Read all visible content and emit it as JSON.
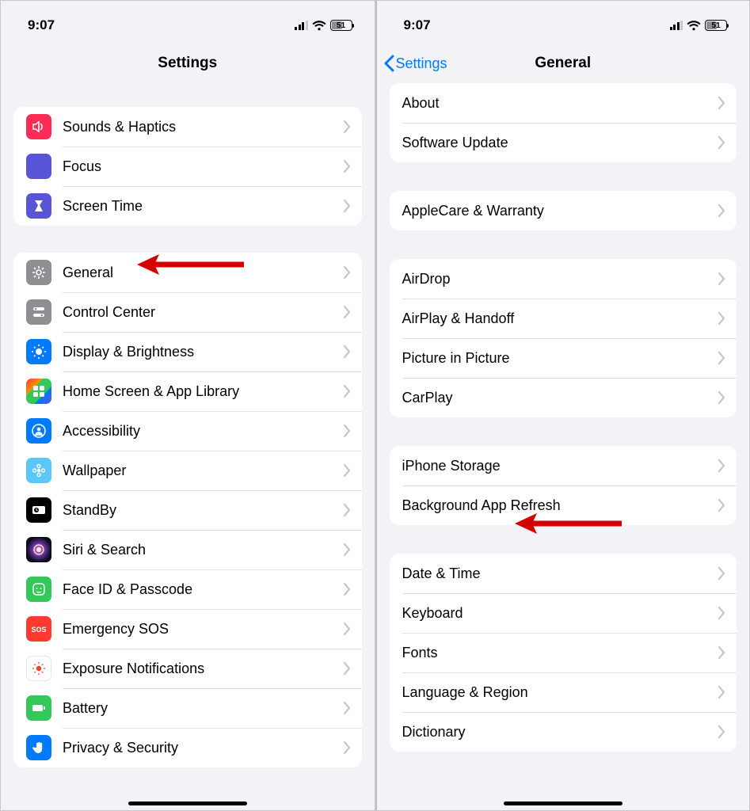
{
  "status": {
    "time": "9:07",
    "battery": "51"
  },
  "left": {
    "navTitle": "Settings",
    "groups": [
      {
        "items": [
          {
            "name": "sounds-haptics",
            "label": "Sounds & Haptics",
            "iconClass": "ic-pink",
            "icon": "speaker"
          },
          {
            "name": "focus",
            "label": "Focus",
            "iconClass": "ic-indigo",
            "icon": "moon"
          },
          {
            "name": "screen-time",
            "label": "Screen Time",
            "iconClass": "ic-hourglass",
            "icon": "hourglass"
          }
        ]
      },
      {
        "items": [
          {
            "name": "general",
            "label": "General",
            "iconClass": "ic-gray",
            "icon": "gear"
          },
          {
            "name": "control-center",
            "label": "Control Center",
            "iconClass": "ic-gray",
            "icon": "switches"
          },
          {
            "name": "display-brightness",
            "label": "Display & Brightness",
            "iconClass": "ic-blue",
            "icon": "sun"
          },
          {
            "name": "home-screen",
            "label": "Home Screen & App Library",
            "iconClass": "ic-multicolor",
            "icon": "grid"
          },
          {
            "name": "accessibility",
            "label": "Accessibility",
            "iconClass": "ic-access",
            "icon": "person-circle"
          },
          {
            "name": "wallpaper",
            "label": "Wallpaper",
            "iconClass": "ic-teal",
            "icon": "flower"
          },
          {
            "name": "standby",
            "label": "StandBy",
            "iconClass": "ic-black",
            "icon": "clock-rect"
          },
          {
            "name": "siri-search",
            "label": "Siri & Search",
            "iconClass": "ic-siri",
            "icon": "siri"
          },
          {
            "name": "face-id",
            "label": "Face ID & Passcode",
            "iconClass": "ic-faceid",
            "icon": "face"
          },
          {
            "name": "emergency-sos",
            "label": "Emergency SOS",
            "iconClass": "ic-sos",
            "icon": "sos"
          },
          {
            "name": "exposure-notifications",
            "label": "Exposure Notifications",
            "iconClass": "ic-exposure",
            "icon": "exposure"
          },
          {
            "name": "battery",
            "label": "Battery",
            "iconClass": "ic-battery",
            "icon": "battery"
          },
          {
            "name": "privacy-security",
            "label": "Privacy & Security",
            "iconClass": "ic-privacy",
            "icon": "hand"
          }
        ]
      }
    ]
  },
  "right": {
    "backLabel": "Settings",
    "navTitle": "General",
    "groups": [
      {
        "items": [
          {
            "name": "about",
            "label": "About"
          },
          {
            "name": "software-update",
            "label": "Software Update"
          }
        ]
      },
      {
        "items": [
          {
            "name": "applecare",
            "label": "AppleCare & Warranty"
          }
        ]
      },
      {
        "items": [
          {
            "name": "airdrop",
            "label": "AirDrop"
          },
          {
            "name": "airplay",
            "label": "AirPlay & Handoff"
          },
          {
            "name": "pip",
            "label": "Picture in Picture"
          },
          {
            "name": "carplay",
            "label": "CarPlay"
          }
        ]
      },
      {
        "items": [
          {
            "name": "iphone-storage",
            "label": "iPhone Storage"
          },
          {
            "name": "background-app-refresh",
            "label": "Background App Refresh"
          }
        ]
      },
      {
        "items": [
          {
            "name": "date-time",
            "label": "Date & Time"
          },
          {
            "name": "keyboard",
            "label": "Keyboard"
          },
          {
            "name": "fonts",
            "label": "Fonts"
          },
          {
            "name": "language-region",
            "label": "Language & Region"
          },
          {
            "name": "dictionary",
            "label": "Dictionary"
          }
        ]
      }
    ]
  },
  "annotations": {
    "leftArrowTarget": "general",
    "rightArrowTarget": "iphone-storage"
  }
}
